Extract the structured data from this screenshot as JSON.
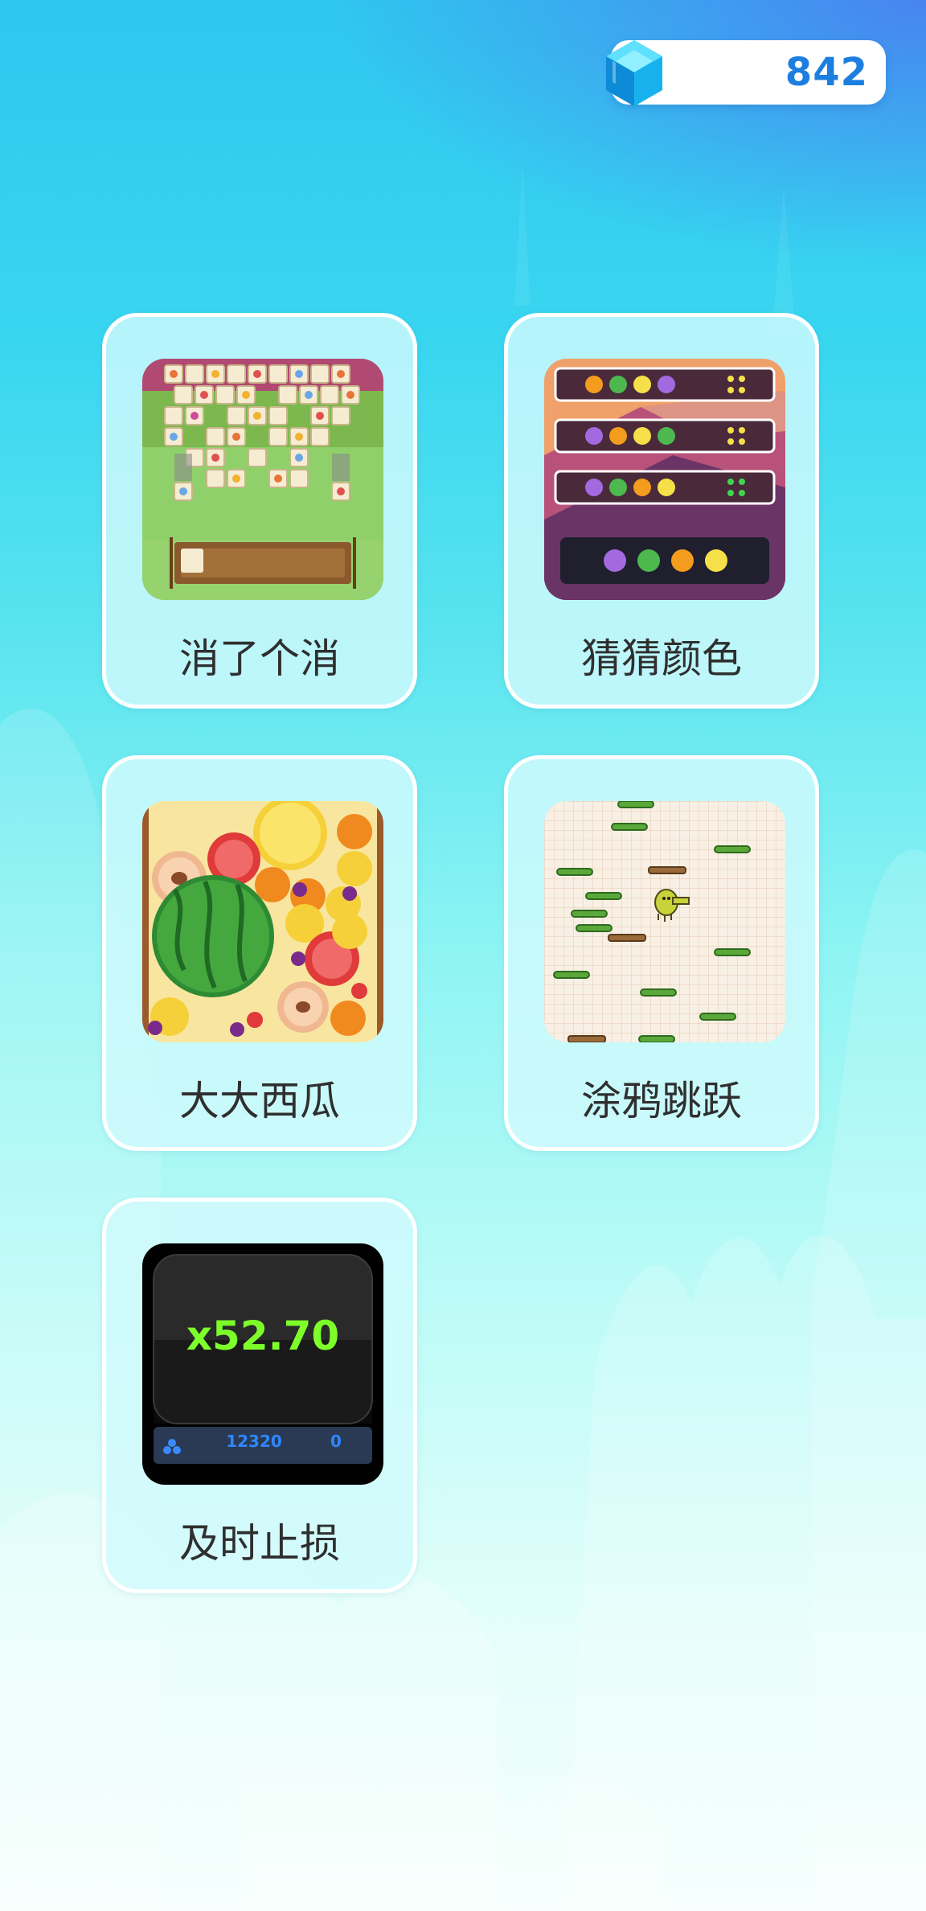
{
  "currency": {
    "icon": "blue-gem-icon",
    "value": "842"
  },
  "games": [
    {
      "name": "消了个消",
      "thumbnail": "tile-match-thumbnail"
    },
    {
      "name": "猜猜颜色",
      "thumbnail": "color-guess-thumbnail"
    },
    {
      "name": "大大西瓜",
      "thumbnail": "watermelon-merge-thumbnail"
    },
    {
      "name": "涂鸦跳跃",
      "thumbnail": "doodle-jump-thumbnail"
    },
    {
      "name": "及时止损",
      "thumbnail": "crash-multiplier-thumbnail",
      "thumbnail_text": {
        "multiplier": "x52.70",
        "score": "12320",
        "count": "0"
      }
    }
  ],
  "colors": {
    "accent": "#1c7fe0",
    "card_border": "#ffffff",
    "card_fill": "#d2fafc",
    "multiplier_green": "#7dff2a"
  }
}
